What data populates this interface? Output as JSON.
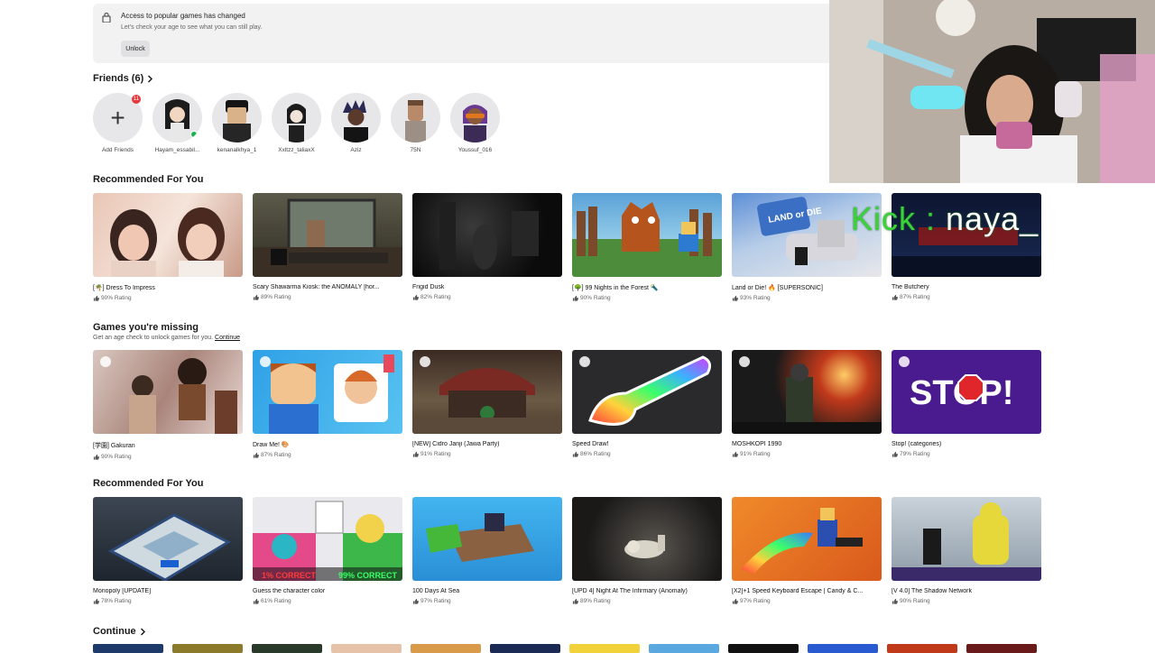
{
  "notice": {
    "title": "Access to popular games has changed",
    "subtitle": "Let's check your age to see what you can still play.",
    "unlock_label": "Unlock"
  },
  "friends": {
    "header": "Friends (6)",
    "add_label": "Add Friends",
    "add_badge": "11",
    "list": [
      {
        "name": "Hayam_essabil...",
        "online": true
      },
      {
        "name": "kenanalkhya_1",
        "online": false
      },
      {
        "name": "Xxltzz_taliaxX",
        "online": false
      },
      {
        "name": "Aziz",
        "online": false
      },
      {
        "name": "75N",
        "online": false
      },
      {
        "name": "Youssuf_016",
        "online": false
      }
    ]
  },
  "sections": [
    {
      "title": "Recommended For You",
      "games": [
        {
          "name": "[🌴] Dress To Impress",
          "rating": "90% Rating"
        },
        {
          "name": "Scary Shawarma Kiosk: the ANOMALY [hor...",
          "rating": "89% Rating"
        },
        {
          "name": "Frigid Dusk",
          "rating": "82% Rating"
        },
        {
          "name": "[🌳] 99 Nights in the Forest 🔦",
          "rating": "90% Rating"
        },
        {
          "name": "Land or Die! 🔥 [SUPERSONIC]",
          "rating": "93% Rating"
        },
        {
          "name": "The Butchery",
          "rating": "87% Rating"
        }
      ]
    },
    {
      "title": "Games you're missing",
      "subtitle": "Get an age check to unlock games for you.",
      "subtitle_link": "Continue",
      "games": [
        {
          "name": "[学園] Gakuran",
          "rating": "90% Rating"
        },
        {
          "name": "Draw Me! 🎨",
          "rating": "87% Rating"
        },
        {
          "name": "[NEW] Cidro Janji (Jawa Party)",
          "rating": "91% Rating"
        },
        {
          "name": "Speed Draw!",
          "rating": "86% Rating"
        },
        {
          "name": "MOSHKOPI 1990",
          "rating": "91% Rating"
        },
        {
          "name": "Stop! (categories)",
          "rating": "79% Rating"
        }
      ]
    },
    {
      "title": "Recommended For You",
      "games": [
        {
          "name": "Monopoly [UPDATE]",
          "rating": "78% Rating"
        },
        {
          "name": "Guess the character color",
          "rating": "61% Rating"
        },
        {
          "name": "100 Days At Sea",
          "rating": "97% Rating"
        },
        {
          "name": "[UPD 4] Night At The Infirmary (Anomaly)",
          "rating": "89% Rating"
        },
        {
          "name": "[X2]+1 Speed Keyboard Escape | Candy & C...",
          "rating": "97% Rating"
        },
        {
          "name": "[V 4.0] The Shadow Network",
          "rating": "90% Rating"
        }
      ]
    }
  ],
  "thumb_art": {
    "s0": [
      "1% CORRECT",
      "99% CORRECT"
    ],
    "stop": "STOP!",
    "land_or_die": "LAND or DIE"
  },
  "continue": {
    "label": "Continue"
  },
  "overlay": {
    "kick_prefix": "Kick :",
    "kick_name": "naya_"
  },
  "colors": {
    "online": "#19b44f",
    "badge": "#e5393d",
    "kick": "#3bd13b"
  }
}
